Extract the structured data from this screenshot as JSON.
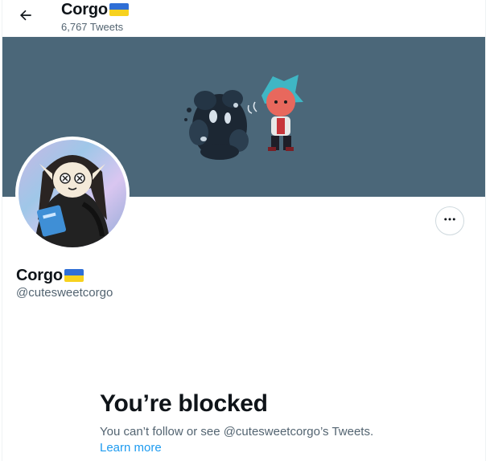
{
  "header": {
    "back_icon": "arrow-left-icon",
    "name": "Corgo",
    "name_flag": "ukraine-flag-icon",
    "tweet_count": "6,767 Tweets"
  },
  "banner": {
    "background_color": "#4b6779"
  },
  "profile": {
    "avatar": "avatar",
    "display_name": "Corgo",
    "display_name_flag": "ukraine-flag-icon",
    "handle": "@cutesweetcorgo",
    "more_icon": "ellipsis-icon"
  },
  "blocked": {
    "title": "You’re blocked",
    "description": "You can’t follow or see @cutesweetcorgo’s Tweets.",
    "link_label": "Learn more"
  },
  "colors": {
    "link": "#1d9bf0",
    "secondary_text": "#536471",
    "primary_text": "#0f1419",
    "flag_blue": "#2f6fd6",
    "flag_yellow": "#f7d21e"
  }
}
